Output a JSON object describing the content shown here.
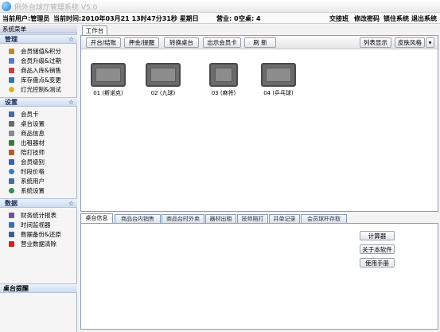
{
  "window": {
    "title": "例外台球厅管理系统 V5.0"
  },
  "status": {
    "current_user": "当前用户:管理员",
    "current_time": "当前时间:2010年03月21 13时47分31秒  星期日",
    "business": "营业: 0",
    "idle": "空桌: 4",
    "links": [
      "交接班",
      "修改密码",
      "锁住系统",
      "退出系统"
    ]
  },
  "sidebar": {
    "title": "系统菜单",
    "sections": [
      {
        "header": "管理",
        "items": [
          {
            "label": "会员储值&积分",
            "icon": "coin-icon",
            "color": "#c08a2a"
          },
          {
            "label": "会员升级&过期",
            "icon": "card-icon",
            "color": "#5a7fb8"
          },
          {
            "label": "商品入库&销售",
            "icon": "box-icon",
            "color": "#c84040"
          },
          {
            "label": "库存盘点&变更",
            "icon": "chart-icon",
            "color": "#3a70b0"
          },
          {
            "label": "灯光控制&测试",
            "icon": "bulb-icon",
            "color": "#e0b020"
          }
        ]
      },
      {
        "header": "设置",
        "items": [
          {
            "label": "会员卡",
            "icon": "member-card-icon",
            "color": "#4a6aa0"
          },
          {
            "label": "桌台设置",
            "icon": "table-icon",
            "color": "#6a6a6a"
          },
          {
            "label": "商品信息",
            "icon": "goods-icon",
            "color": "#8a8a8a"
          },
          {
            "label": "出租器材",
            "icon": "cue-icon",
            "color": "#3a7a40"
          },
          {
            "label": "陪打技师",
            "icon": "person-icon",
            "color": "#b06030"
          },
          {
            "label": "会员级别",
            "icon": "level-icon",
            "color": "#4060a8"
          },
          {
            "label": "时段价格",
            "icon": "clock-icon",
            "color": "#3a80b8"
          },
          {
            "label": "系统用户",
            "icon": "users-icon",
            "color": "#4a6a9a"
          },
          {
            "label": "系统设置",
            "icon": "gear-icon",
            "color": "#3a8a5a"
          }
        ]
      },
      {
        "header": "数据",
        "items": [
          {
            "label": "财务统计报表",
            "icon": "report-icon",
            "color": "#7050a0"
          },
          {
            "label": "时间监视器",
            "icon": "monitor-icon",
            "color": "#3a70b0"
          },
          {
            "label": "数据备份&还原",
            "icon": "backup-icon",
            "color": "#3a6090"
          },
          {
            "label": "营业数据清除",
            "icon": "delete-icon",
            "color": "#d02020"
          }
        ]
      }
    ],
    "collapse_glyph": "☆",
    "reminder_title": "桌台提醒"
  },
  "workspace": {
    "tab_label": "工作台",
    "toolbar": {
      "open_close": "开台/结账",
      "deposit": "押金/提醒",
      "switch_table": "转换桌台",
      "sell_card": "出示会员卡",
      "refresh": "刷 新",
      "list_view": "列表显示",
      "skin": "皮肤风格",
      "skin_arrow": "▾"
    },
    "tables": [
      {
        "label": "01 (斯诺克)"
      },
      {
        "label": "02 (九球)"
      },
      {
        "label": "03 (麻将)"
      },
      {
        "label": "04 (乒乓球)"
      }
    ]
  },
  "bottom": {
    "tabs": [
      "桌台信息",
      "商品台内销售",
      "商品台时外卖",
      "器材出租",
      "技师陪打",
      "并单记录",
      "会员球杆存取"
    ],
    "buttons": {
      "calculator": "计算器",
      "about": "关于本软件",
      "manual": "使用手册"
    }
  }
}
